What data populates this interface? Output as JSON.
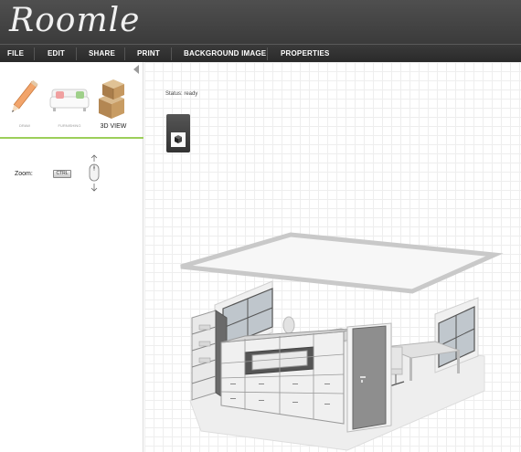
{
  "app": {
    "logo_text": "Roomle"
  },
  "menu": [
    {
      "label": "FILE"
    },
    {
      "label": "EDIT"
    },
    {
      "label": "SHARE"
    },
    {
      "label": "PRINT"
    },
    {
      "label": "BACKGROUND IMAGE"
    },
    {
      "label": "PROPERTIES"
    }
  ],
  "sidebar": {
    "tabs": [
      {
        "label": "DRAW",
        "icon": "pencil-icon",
        "active": false
      },
      {
        "label": "FURNISHING",
        "icon": "sofa-icon",
        "active": false
      },
      {
        "label": "3D VIEW",
        "icon": "boxes-icon",
        "active": true
      }
    ],
    "zoom_label": "Zoom:",
    "zoom_key": "CTRL"
  },
  "canvas": {
    "status": "Status: ready"
  },
  "colors": {
    "header": "#444444",
    "menubar": "#2e2e2e",
    "accent_green": "#9ccf5a"
  }
}
